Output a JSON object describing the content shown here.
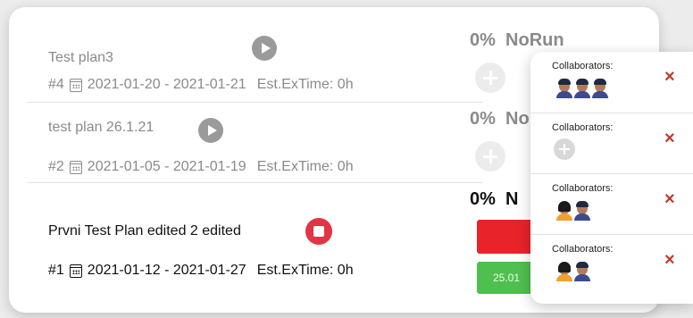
{
  "plans": [
    {
      "name": "Test plan3",
      "id": "#4",
      "dates": "2021-01-20 - 2021-01-21",
      "est": "Est.ExTime: 0h",
      "percent": "0%",
      "status": "NoRun",
      "state": "play"
    },
    {
      "name": "test plan 26.1.21",
      "id": "#2",
      "dates": "2021-01-05 - 2021-01-19",
      "est": "Est.ExTime: 0h",
      "percent": "0%",
      "status": "No",
      "state": "play"
    },
    {
      "name": "Prvni Test Plan edited 2 edited",
      "id": "#1",
      "dates": "2021-01-12 - 2021-01-27",
      "est": "Est.ExTime: 0h",
      "percent": "0%",
      "status": "N",
      "state": "running",
      "progress_green_label": "25.01"
    }
  ],
  "collaborators_popup": {
    "items": [
      {
        "label": "Collaborators:",
        "avatars": [
          "male",
          "male",
          "male"
        ],
        "close": "×"
      },
      {
        "label": "Collaborators:",
        "avatars": [
          "add"
        ],
        "close": "×"
      },
      {
        "label": "Collaborators:",
        "avatars": [
          "female",
          "male"
        ],
        "close": "×"
      },
      {
        "label": "Collaborators:",
        "avatars": [
          "female",
          "male"
        ],
        "close": "×"
      }
    ]
  },
  "colors": {
    "stop_red": "#e03545",
    "bar_red": "#e8232a",
    "bar_green": "#4fbf4f",
    "close_red": "#c0392b"
  }
}
